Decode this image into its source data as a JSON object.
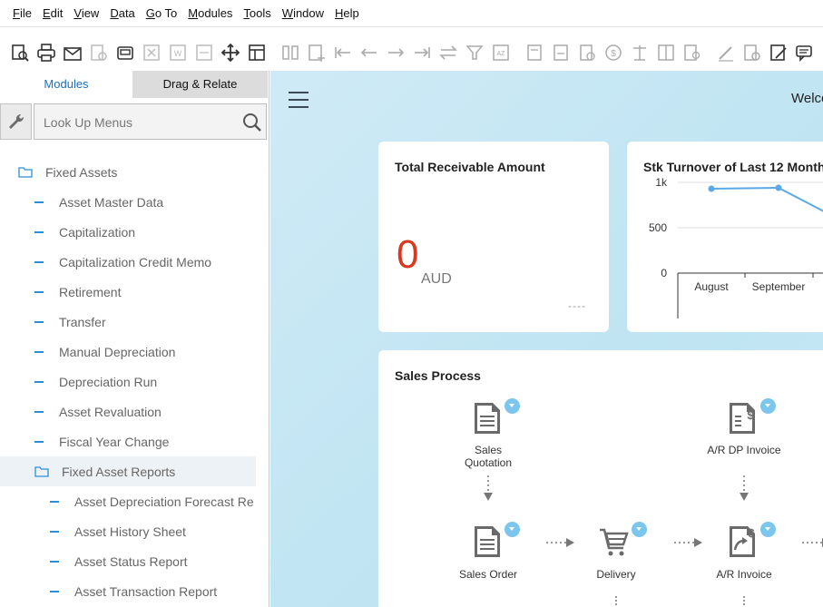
{
  "menu": [
    "File",
    "Edit",
    "View",
    "Data",
    "Go To",
    "Modules",
    "Tools",
    "Window",
    "Help"
  ],
  "menu_accel": [
    "F",
    "E",
    "V",
    "D",
    "G",
    "M",
    "T",
    "W",
    "H"
  ],
  "left_panel": {
    "tabs": [
      {
        "label": "Modules",
        "active": true
      },
      {
        "label": "Drag & Relate",
        "active": false
      }
    ],
    "search": {
      "placeholder": "Look Up Menus",
      "value": ""
    },
    "tree": [
      {
        "label": "Fixed Assets",
        "level": 0,
        "type": "folder"
      },
      {
        "label": "Asset Master Data",
        "level": 1,
        "type": "item"
      },
      {
        "label": "Capitalization",
        "level": 1,
        "type": "item"
      },
      {
        "label": "Capitalization Credit Memo",
        "level": 1,
        "type": "item"
      },
      {
        "label": "Retirement",
        "level": 1,
        "type": "item"
      },
      {
        "label": "Transfer",
        "level": 1,
        "type": "item"
      },
      {
        "label": "Manual Depreciation",
        "level": 1,
        "type": "item"
      },
      {
        "label": "Depreciation Run",
        "level": 1,
        "type": "item"
      },
      {
        "label": "Asset Revaluation",
        "level": 1,
        "type": "item"
      },
      {
        "label": "Fiscal Year Change",
        "level": 1,
        "type": "item"
      },
      {
        "label": "Fixed Asset Reports",
        "level": 1,
        "type": "folder",
        "selected": true
      },
      {
        "label": "Asset Depreciation Forecast Re",
        "level": 2,
        "type": "item"
      },
      {
        "label": "Asset History Sheet",
        "level": 2,
        "type": "item"
      },
      {
        "label": "Asset Status Report",
        "level": 2,
        "type": "item"
      },
      {
        "label": "Asset Transaction Report",
        "level": 2,
        "type": "item"
      }
    ]
  },
  "main": {
    "welcome": "Welco",
    "receivable_card": {
      "title": "Total Receivable Amount",
      "value": "0",
      "currency": "AUD",
      "footer": "----"
    },
    "turnover_card": {
      "title": "Stk Turnover of Last 12 Month",
      "y_ticks": [
        "1k",
        "500",
        "0"
      ],
      "x_labels": [
        "August",
        "September"
      ]
    },
    "sales_card": {
      "title": "Sales Process",
      "steps": {
        "quotation": "Sales\nQuotation",
        "dp_invoice": "A/R DP Invoice",
        "order": "Sales Order",
        "delivery": "Delivery",
        "invoice": "A/R Invoice"
      }
    }
  },
  "chart_data": {
    "type": "line",
    "title": "Stk Turnover of Last 12 Month",
    "categories": [
      "August",
      "September"
    ],
    "series": [
      {
        "values": [
          930,
          940
        ]
      }
    ],
    "ylim": [
      0,
      1000
    ],
    "y_ticks": [
      "0",
      "500",
      "1k"
    ],
    "grid": true,
    "line_color": "#5aa9e6"
  },
  "colors": {
    "accent": "#2a8fd8",
    "amount": "#d9391e",
    "badge": "#7cc6ee"
  }
}
